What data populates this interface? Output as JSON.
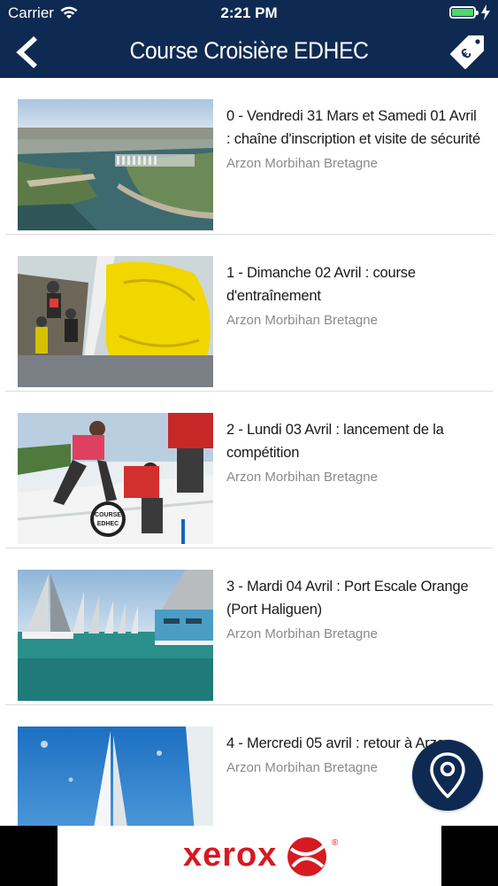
{
  "status": {
    "carrier": "Carrier",
    "time": "2:21 PM"
  },
  "navbar": {
    "title": "Course Croisière EDHEC",
    "back_icon": "chevron-left-icon",
    "action_icon": "price-tag-euro-icon"
  },
  "events": [
    {
      "title": "0 - Vendredi 31 Mars et Samedi 01 Avril : chaîne d'inscription et visite de sécurité",
      "location": "Arzon Morbihan Bretagne"
    },
    {
      "title": "1 - Dimanche 02 Avril : course d'entraînement",
      "location": "Arzon Morbihan Bretagne"
    },
    {
      "title": "2 - Lundi 03 Avril : lancement de la compétition",
      "location": "Arzon Morbihan Bretagne"
    },
    {
      "title": "3 - Mardi 04 Avril : Port Escale Orange (Port Haliguen)",
      "location": "Arzon Morbihan Bretagne"
    },
    {
      "title": "4 - Mercredi 05 avril : retour à Arzon",
      "location": "Arzon Morbihan Bretagne"
    }
  ],
  "thumb_badge": {
    "line1": "COURSE",
    "line2": "EDHEC"
  },
  "fab": {
    "icon": "map-pin-icon"
  },
  "banner": {
    "brand": "xerox",
    "reg": "®"
  },
  "colors": {
    "navy": "#0f2a52",
    "brand_red": "#d71920",
    "battery": "#4cd964"
  }
}
